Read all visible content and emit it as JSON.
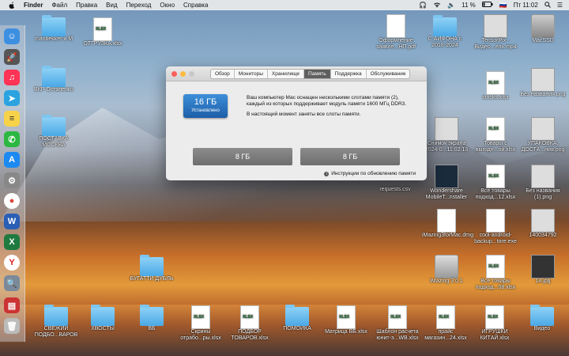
{
  "menubar": {
    "app": "Finder",
    "items": [
      "Файл",
      "Правка",
      "Вид",
      "Переход",
      "Окно",
      "Справка"
    ],
    "battery": "11 %",
    "clock": "Пт 11:02"
  },
  "dock": {
    "icons": [
      "finder-icon",
      "launchpad-icon",
      "itunes-icon",
      "telegram-icon",
      "notes-icon",
      "whatsapp-icon",
      "appstore-icon",
      "system-preferences-icon",
      "chrome-icon",
      "word-icon",
      "excel-icon",
      "yandex-icon",
      "preview-icon",
      "stocks-icon",
      "trash-icon"
    ]
  },
  "desktop": {
    "left_column": [
      {
        "label": "manbekker и М",
        "kind": "folder"
      },
      {
        "label": "ВКР Остапенко",
        "kind": "folder"
      },
      {
        "label": "ПОСТАВКА МОСКВА",
        "kind": "folder"
      }
    ],
    "top_row": [
      {
        "label": "ОТГРУЗКА.xlsx",
        "kind": "xlsx"
      }
    ],
    "middle": [
      {
        "label": "БУГАТТИ ДУБЛЬ",
        "kind": "folder"
      },
      {
        "label": "requests.csv",
        "kind": "csv"
      }
    ],
    "bottom_row": [
      {
        "label": "СВЕЖИЙ ПОДБО...ВАРОВ",
        "kind": "folder"
      },
      {
        "label": "ХВОСТЫ",
        "kind": "folder"
      },
      {
        "label": "ВБ",
        "kind": "folder"
      },
      {
        "label": "Скрины отрабо...ры.xlsx",
        "kind": "xlsx"
      },
      {
        "label": "ПОДБОР ТОВАРОВ.xlsx",
        "kind": "xlsx"
      },
      {
        "label": "ПОМОЙКА",
        "kind": "folder"
      },
      {
        "label": "Матрица ВБ.xlsx",
        "kind": "xlsx"
      },
      {
        "label": "Шаблон расчета юнит-э...WB.xlsx",
        "kind": "xlsx"
      },
      {
        "label": "прайс магазин...24.xlsx",
        "kind": "xlsx"
      },
      {
        "label": "ИГРУШКИ КИТАЙ.xlsx",
        "kind": "xlsx"
      },
      {
        "label": "Видео",
        "kind": "folder"
      }
    ],
    "right_cols": [
      {
        "label": "Оформление заявле...НП.pdf",
        "kind": "pdf"
      },
      {
        "label": "С АЙФОНА с 2018-2024",
        "kind": "folder"
      },
      {
        "label": "TensorPix - Видео...ель.mp4",
        "kind": "video"
      },
      {
        "label": "MacSSD",
        "kind": "disk"
      },
      {
        "label": "stocks.xlsx",
        "kind": "xlsx"
      },
      {
        "label": "Без названия.png",
        "kind": "png"
      },
      {
        "label": "Снимок экрана 2024-0...11.02.13",
        "kind": "png"
      },
      {
        "label": "Товары с выгодн...ой.xlsx",
        "kind": "xlsx"
      },
      {
        "label": "УПАКОВКА, ДОСТА...ния.png",
        "kind": "png"
      },
      {
        "label": "Wondershare MobileT...nstaller",
        "kind": "app"
      },
      {
        "label": "Все товары подход...12.xlsx",
        "kind": "xlsx"
      },
      {
        "label": "Без названия (1).png",
        "kind": "png"
      },
      {
        "label": "iMazing3forMac.dmg",
        "kind": "dmg"
      },
      {
        "label": "cool-android-backup...tore.exe",
        "kind": "exe"
      },
      {
        "label": "140034792",
        "kind": "png"
      },
      {
        "label": "iMazing 3.0.1",
        "kind": "disk"
      },
      {
        "label": "Все товары подход...08.xlsx",
        "kind": "xlsx"
      },
      {
        "label": "14.jpg",
        "kind": "jpg"
      }
    ]
  },
  "window": {
    "tabs": [
      "Обзор",
      "Мониторы",
      "Хранилище",
      "Память",
      "Поддержка",
      "Обслуживание"
    ],
    "active_tab": "Память",
    "memory_total": "16 ГБ",
    "memory_status": "Установлено",
    "description_line1": "Ваш компьютер Mac оснащен несколькими слотами памяти (2),",
    "description_line2": "каждый из которых поддерживает модуль памяти 1600 МГц DDR3.",
    "description_line3": "В настоящий момент заняты все слоты памяти.",
    "slot1": "8 ГБ",
    "slot2": "8 ГБ",
    "instructions_link": "Инструкции по обновлению памяти"
  }
}
